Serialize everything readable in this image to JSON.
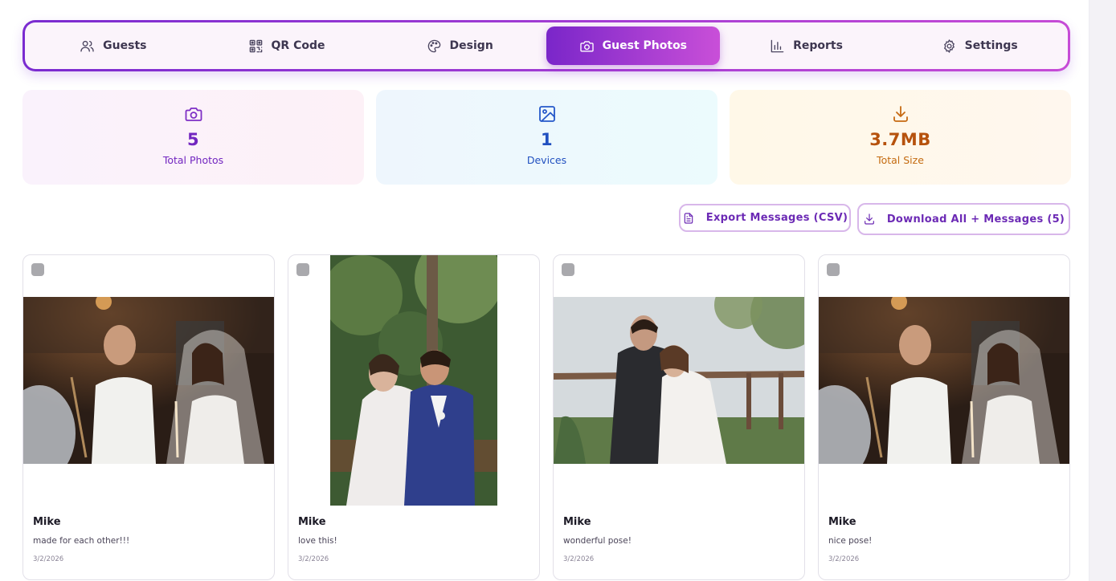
{
  "tabs": [
    {
      "label": "Guests",
      "icon": "users-icon"
    },
    {
      "label": "QR Code",
      "icon": "qr-code-icon"
    },
    {
      "label": "Design",
      "icon": "palette-icon"
    },
    {
      "label": "Guest Photos",
      "icon": "camera-icon",
      "active": true
    },
    {
      "label": "Reports",
      "icon": "bar-chart-icon"
    },
    {
      "label": "Settings",
      "icon": "gear-icon"
    }
  ],
  "stats": {
    "photos": {
      "value": "5",
      "label": "Total Photos",
      "icon": "camera-icon"
    },
    "devices": {
      "value": "1",
      "label": "Devices",
      "icon": "image-icon"
    },
    "size": {
      "value": "3.7MB",
      "label": "Total Size",
      "icon": "download-icon"
    }
  },
  "actions": {
    "export_label": "Export Messages (CSV)",
    "download_label": "Download All + Messages (5)"
  },
  "photos": [
    {
      "name": "Mike",
      "message": "made for each other!!!",
      "date": "3/2/2026",
      "orientation": "landscape"
    },
    {
      "name": "Mike",
      "message": "love this!",
      "date": "3/2/2026",
      "orientation": "portrait"
    },
    {
      "name": "Mike",
      "message": "wonderful pose!",
      "date": "3/2/2026",
      "orientation": "landscape"
    },
    {
      "name": "Mike",
      "message": "nice pose!",
      "date": "3/2/2026",
      "orientation": "landscape"
    }
  ],
  "colors": {
    "accent_start": "#7a26c9",
    "accent_end": "#c94fd8",
    "photos_stat": "#7226c0",
    "devices_stat": "#2150c0",
    "size_stat": "#b6520d"
  }
}
